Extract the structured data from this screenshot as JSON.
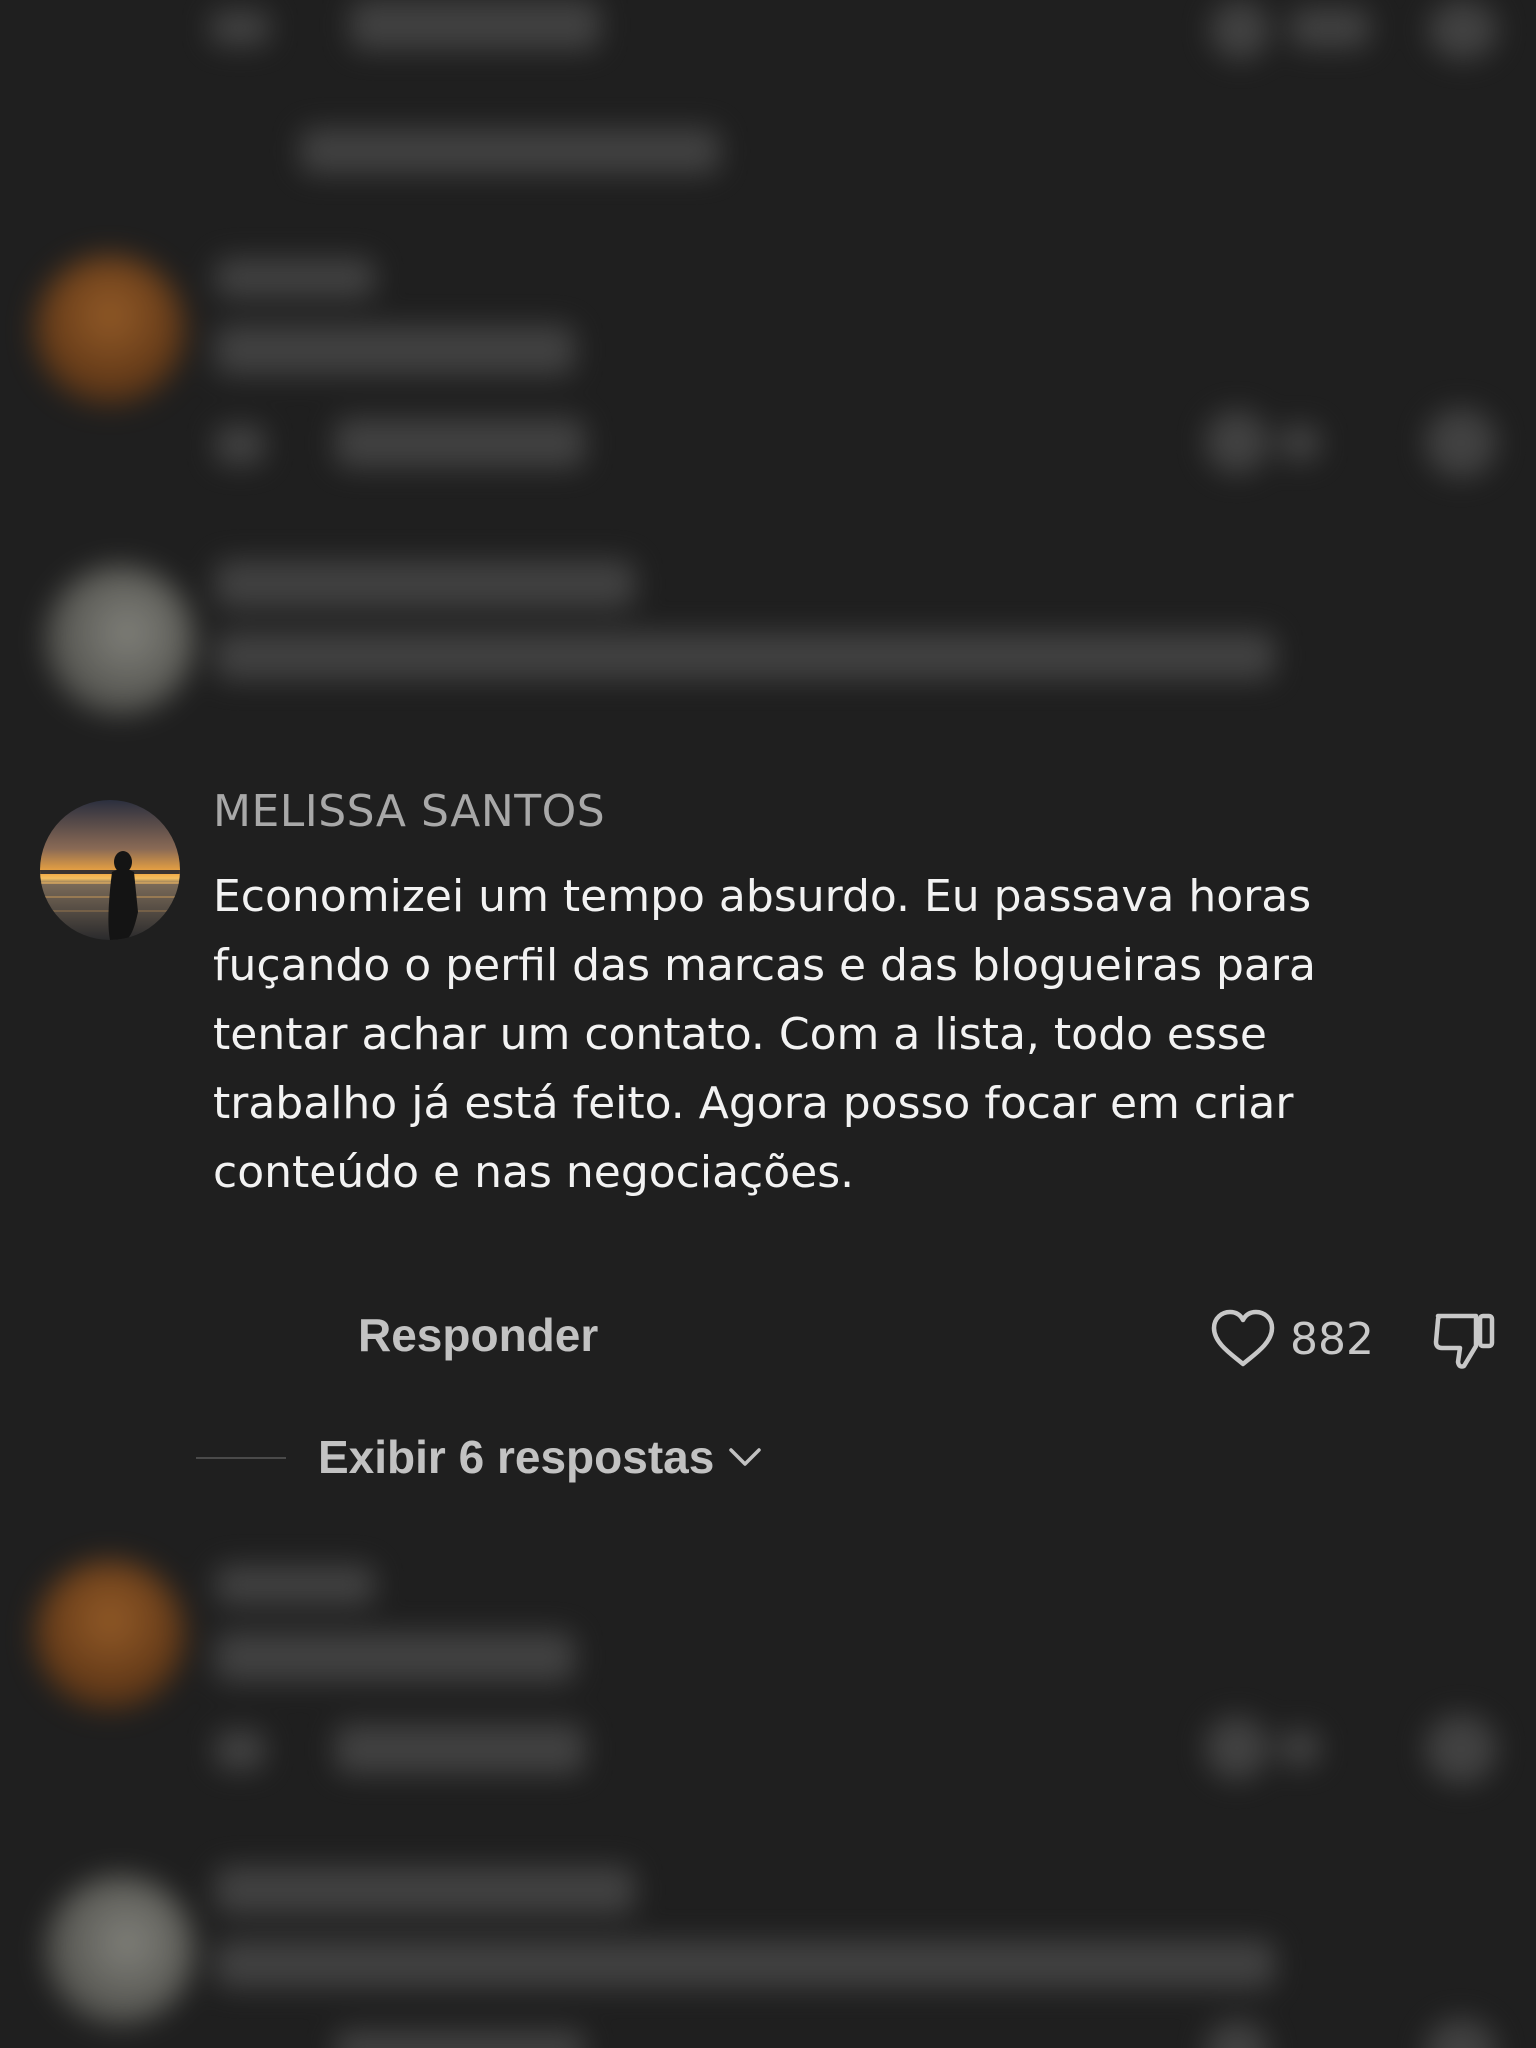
{
  "comment": {
    "author": "MELISSA SANTOS",
    "text": "Economizei um tempo absurdo. Eu passava horas fuçando o perfil das marcas e das blogueiras para tentar achar um contato. Com a lista, todo esse trabalho já está feito. Agora posso focar em criar conteúdo e nas negociações.",
    "reply_label": "Responder",
    "like_count": "882",
    "show_replies_label": "Exibir 6 respostas"
  },
  "colors": {
    "background": "#1f1f1f",
    "author": "#a8a8a8",
    "text": "#f2f2f2",
    "action": "#c2c2c2"
  },
  "icons": {
    "like": "heart-outline-icon",
    "dislike": "thumbs-down-icon",
    "expand": "chevron-down-icon"
  }
}
